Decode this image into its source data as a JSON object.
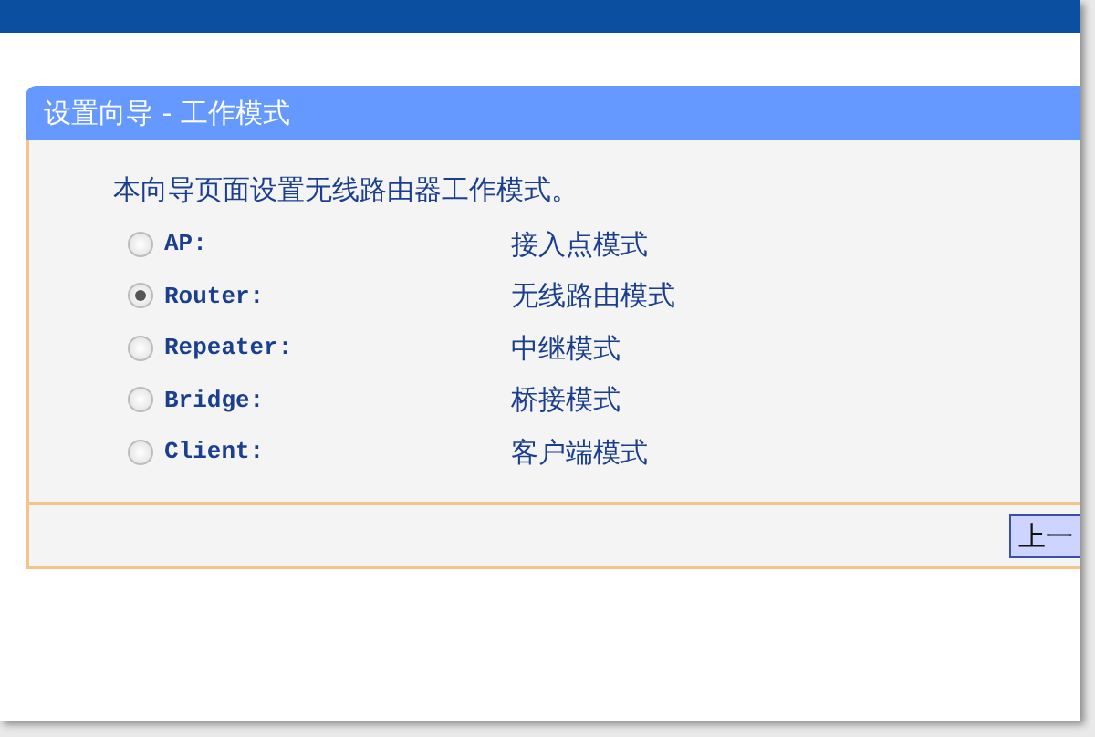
{
  "panel": {
    "title": "设置向导 - 工作模式",
    "intro": "本向导页面设置无线路由器工作模式。",
    "modes": [
      {
        "label": "AP:",
        "description": "接入点模式",
        "selected": false
      },
      {
        "label": "Router:",
        "description": "无线路由模式",
        "selected": true
      },
      {
        "label": "Repeater:",
        "description": "中继模式",
        "selected": false
      },
      {
        "label": "Bridge:",
        "description": "桥接模式",
        "selected": false
      },
      {
        "label": "Client:",
        "description": "客户端模式",
        "selected": false
      }
    ],
    "buttons": [
      "上一"
    ]
  }
}
